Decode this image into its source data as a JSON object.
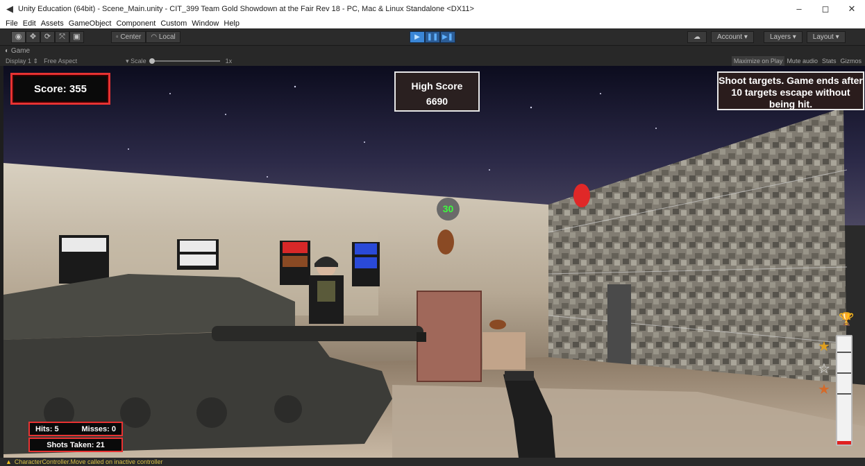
{
  "window": {
    "title": "Unity Education (64bit) - Scene_Main.unity - CIT_399 Team Gold Showdown at the Fair Rev 18 - PC, Mac & Linux Standalone <DX11>",
    "app_icon": "unity-icon",
    "controls": {
      "minimize": "–",
      "maximize": "◻",
      "close": "✕"
    }
  },
  "menu": {
    "items": [
      "File",
      "Edit",
      "Assets",
      "GameObject",
      "Component",
      "Custom",
      "Window",
      "Help"
    ]
  },
  "toolbar": {
    "tools": [
      {
        "name": "view-tool-icon",
        "glyph": "◉"
      },
      {
        "name": "move-tool-icon",
        "glyph": "✥"
      },
      {
        "name": "rotate-tool-icon",
        "glyph": "⟳"
      },
      {
        "name": "scale-tool-icon",
        "glyph": "⤧"
      },
      {
        "name": "rect-tool-icon",
        "glyph": "▣"
      }
    ],
    "pivot_label": "Center",
    "space_label": "Local",
    "play_glyph": "▶",
    "pause_glyph": "❚❚",
    "step_glyph": "▶❚",
    "cloud_glyph": "☁",
    "account_label": "Account",
    "layers_label": "Layers",
    "layout_label": "Layout",
    "dropdown_glyph": "▾"
  },
  "game_view": {
    "tab_label": "Game",
    "display_label": "Display 1",
    "aspect_label": "Free Aspect",
    "scale_label": "Scale",
    "scale_value": "1x",
    "maximize_label": "Maximize on Play",
    "mute_label": "Mute audio",
    "stats_label": "Stats",
    "gizmos_label": "Gizmos"
  },
  "hud": {
    "score_text": "Score: 355",
    "high_score_label": "High Score",
    "high_score_value": "6690",
    "rules_text": "Shoot targets. Game ends after 10 targets escape without being hit.",
    "hits_text": "Hits: 5",
    "misses_text": "Misses: 0",
    "shots_text": "Shots Taken: 21",
    "timer_value": "30",
    "progress_fraction": 0.03,
    "trophy_icon": "🏆",
    "stars": [
      {
        "name": "gold-star-icon",
        "color": "#e0a020"
      },
      {
        "name": "silver-star-icon",
        "color": "#e8e8e8"
      },
      {
        "name": "bronze-star-icon",
        "color": "#d46a2a"
      }
    ]
  },
  "status": {
    "warning_glyph": "▲",
    "message": "CharacterController.Move called on inactive controller"
  },
  "colors": {
    "accent_red": "#e83232",
    "play_blue": "#3a86d6",
    "timer_green": "#3dfc3d"
  }
}
